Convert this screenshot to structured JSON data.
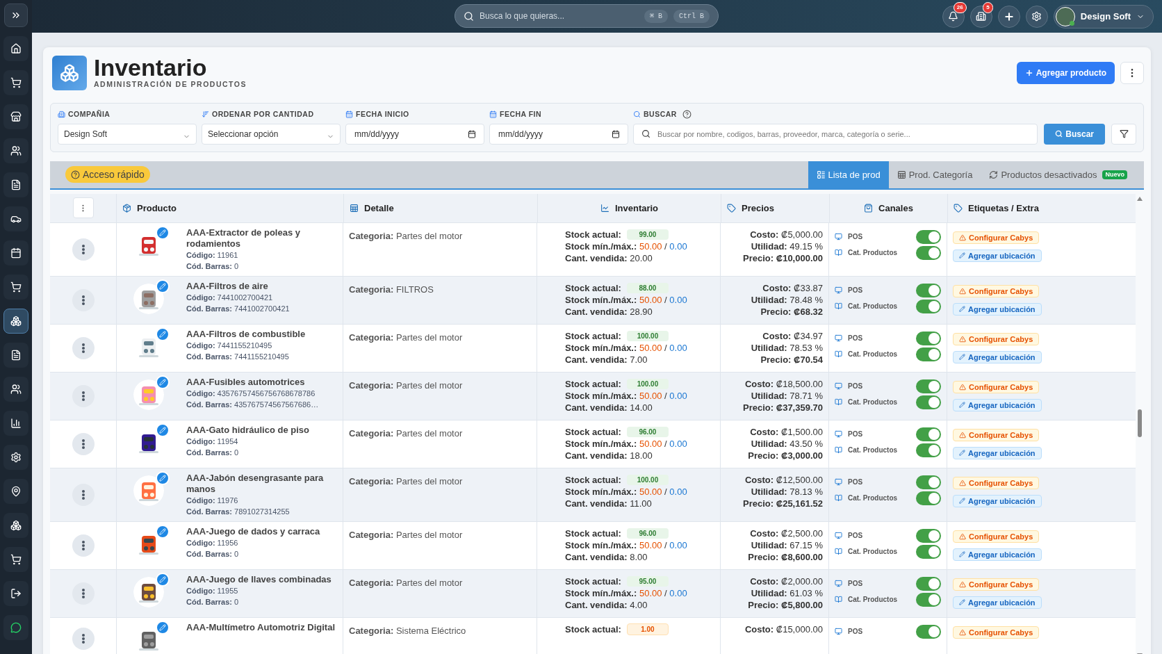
{
  "sidebar": {
    "items": [
      {
        "selected": false
      },
      {
        "selected": false
      },
      {
        "selected": false
      },
      {
        "selected": false
      },
      {
        "selected": false
      },
      {
        "selected": false
      },
      {
        "selected": false
      },
      {
        "selected": false
      },
      {
        "selected": true
      },
      {
        "selected": false
      },
      {
        "selected": false
      },
      {
        "selected": false
      },
      {
        "selected": false
      },
      {
        "selected": false
      },
      {
        "selected": false
      },
      {
        "selected": false
      },
      {
        "selected": false
      }
    ]
  },
  "topbar": {
    "search": {
      "placeholder": "Busca lo que quieras...",
      "keys": [
        "⌘ B",
        "Ctrl B"
      ]
    },
    "notifications": "26",
    "alerts": "5",
    "user": "Design Soft"
  },
  "header": {
    "title": "Inventario",
    "subtitle": "ADMINISTRACIÓN DE PRODUCTOS",
    "add_button": "Agregar producto"
  },
  "filters": {
    "company": {
      "label": "COMPAÑIA",
      "value": "Design Soft"
    },
    "order": {
      "label": "ORDENAR POR CANTIDAD",
      "value": "Seleccionar opción"
    },
    "start": {
      "label": "FECHA INICIO",
      "placeholder": "mm/dd/yyyy"
    },
    "end": {
      "label": "FECHA FIN",
      "placeholder": "mm/dd/yyyy"
    },
    "search": {
      "label": "BUSCAR",
      "placeholder": "Buscar por nombre, codigos, barras, proveedor, marca, categoría o serie..."
    },
    "search_button": "Buscar"
  },
  "quick_access": "Acceso rápido",
  "tabs": [
    {
      "label": "Lista de prod",
      "selected": true
    },
    {
      "label": "Prod. Categoría",
      "selected": false
    },
    {
      "label": "Productos desactivados",
      "selected": false,
      "badge": "Nuevo"
    }
  ],
  "table": {
    "columns": [
      "Producto",
      "Detalle",
      "Inventario",
      "Precios",
      "Canales",
      "Etiquetas / Extra"
    ],
    "rows": [
      {
        "name": "AAA-Extractor de poleas y rodamientos",
        "codes": [
          {
            "label": "Código:",
            "value": "11961"
          },
          {
            "label": "Cód. Barras:",
            "value": "0"
          }
        ],
        "detail": {
          "label": "Categoria:",
          "value": "Partes del motor"
        },
        "stock": {
          "label": "Stock actual:",
          "value": "99.00",
          "low": false
        },
        "minmax": {
          "label": "Stock mín./máx.:",
          "min": "50.00",
          "sep": "/",
          "max": "0.00"
        },
        "sold": {
          "label": "Cant. vendida:",
          "value": "20.00"
        },
        "prices": [
          {
            "label": "Costo:",
            "value": "₡5,000.00",
            "bold": false
          },
          {
            "label": "Utilidad:",
            "value": "49.15 %",
            "bold": false
          },
          {
            "label": "Precio:",
            "value": "₡10,000.00",
            "bold": true
          }
        ],
        "channels": [
          {
            "label": "POS",
            "on": true
          },
          {
            "label": "Cat. Productos",
            "on": true
          }
        ],
        "tags": [
          {
            "kind": "warning",
            "label": "Configurar Cabys"
          },
          {
            "kind": "location",
            "label": "Agregar ubicación"
          }
        ]
      },
      {
        "name": "AAA-Filtros de aire",
        "codes": [
          {
            "label": "Código:",
            "value": "7441002700421"
          },
          {
            "label": "Cód. Barras:",
            "value": "7441002700421"
          }
        ],
        "detail": {
          "label": "Categoria:",
          "value": "FILTROS"
        },
        "stock": {
          "label": "Stock actual:",
          "value": "88.00",
          "low": false
        },
        "minmax": {
          "label": "Stock mín./máx.:",
          "min": "50.00",
          "sep": "/",
          "max": "0.00"
        },
        "sold": {
          "label": "Cant. vendida:",
          "value": "28.90"
        },
        "prices": [
          {
            "label": "Costo:",
            "value": "₡33.87",
            "bold": false
          },
          {
            "label": "Utilidad:",
            "value": "78.48 %",
            "bold": false
          },
          {
            "label": "Precio:",
            "value": "₡68.32",
            "bold": true
          }
        ],
        "channels": [
          {
            "label": "POS",
            "on": true
          },
          {
            "label": "Cat. Productos",
            "on": true
          }
        ],
        "tags": [
          {
            "kind": "warning",
            "label": "Configurar Cabys"
          },
          {
            "kind": "location",
            "label": "Agregar ubicación"
          }
        ]
      },
      {
        "name": "AAA-Filtros de combustible",
        "codes": [
          {
            "label": "Código:",
            "value": "7441155210495"
          },
          {
            "label": "Cód. Barras:",
            "value": "7441155210495"
          }
        ],
        "detail": {
          "label": "Categoria:",
          "value": "Partes del motor"
        },
        "stock": {
          "label": "Stock actual:",
          "value": "100.00",
          "low": false
        },
        "minmax": {
          "label": "Stock mín./máx.:",
          "min": "50.00",
          "sep": "/",
          "max": "0.00"
        },
        "sold": {
          "label": "Cant. vendida:",
          "value": "7.00"
        },
        "prices": [
          {
            "label": "Costo:",
            "value": "₡34.97",
            "bold": false
          },
          {
            "label": "Utilidad:",
            "value": "78.53 %",
            "bold": false
          },
          {
            "label": "Precio:",
            "value": "₡70.54",
            "bold": true
          }
        ],
        "channels": [
          {
            "label": "POS",
            "on": true
          },
          {
            "label": "Cat. Productos",
            "on": true
          }
        ],
        "tags": [
          {
            "kind": "warning",
            "label": "Configurar Cabys"
          },
          {
            "kind": "location",
            "label": "Agregar ubicación"
          }
        ]
      },
      {
        "name": "AAA-Fusibles automotrices",
        "codes": [
          {
            "label": "Código:",
            "value": "43576757456756768678786"
          },
          {
            "label": "Cód. Barras:",
            "value": "435767574567567686…"
          }
        ],
        "detail": {
          "label": "Categoria:",
          "value": "Partes del motor"
        },
        "stock": {
          "label": "Stock actual:",
          "value": "100.00",
          "low": false
        },
        "minmax": {
          "label": "Stock mín./máx.:",
          "min": "50.00",
          "sep": "/",
          "max": "0.00"
        },
        "sold": {
          "label": "Cant. vendida:",
          "value": "14.00"
        },
        "prices": [
          {
            "label": "Costo:",
            "value": "₡18,500.00",
            "bold": false
          },
          {
            "label": "Utilidad:",
            "value": "78.71 %",
            "bold": false
          },
          {
            "label": "Precio:",
            "value": "₡37,359.70",
            "bold": true
          }
        ],
        "channels": [
          {
            "label": "POS",
            "on": true
          },
          {
            "label": "Cat. Productos",
            "on": true
          }
        ],
        "tags": [
          {
            "kind": "warning",
            "label": "Configurar Cabys"
          },
          {
            "kind": "location",
            "label": "Agregar ubicación"
          }
        ]
      },
      {
        "name": "AAA-Gato hidráulico de piso",
        "codes": [
          {
            "label": "Código:",
            "value": "11954"
          },
          {
            "label": "Cód. Barras:",
            "value": "0"
          }
        ],
        "detail": {
          "label": "Categoria:",
          "value": "Partes del motor"
        },
        "stock": {
          "label": "Stock actual:",
          "value": "96.00",
          "low": false
        },
        "minmax": {
          "label": "Stock mín./máx.:",
          "min": "50.00",
          "sep": "/",
          "max": "0.00"
        },
        "sold": {
          "label": "Cant. vendida:",
          "value": "18.00"
        },
        "prices": [
          {
            "label": "Costo:",
            "value": "₡1,500.00",
            "bold": false
          },
          {
            "label": "Utilidad:",
            "value": "43.50 %",
            "bold": false
          },
          {
            "label": "Precio:",
            "value": "₡3,000.00",
            "bold": true
          }
        ],
        "channels": [
          {
            "label": "POS",
            "on": true
          },
          {
            "label": "Cat. Productos",
            "on": true
          }
        ],
        "tags": [
          {
            "kind": "warning",
            "label": "Configurar Cabys"
          },
          {
            "kind": "location",
            "label": "Agregar ubicación"
          }
        ]
      },
      {
        "name": "AAA-Jabón desengrasante para manos",
        "codes": [
          {
            "label": "Código:",
            "value": "11976"
          },
          {
            "label": "Cód. Barras:",
            "value": "7891027314255"
          }
        ],
        "detail": {
          "label": "Categoria:",
          "value": "Partes del motor"
        },
        "stock": {
          "label": "Stock actual:",
          "value": "100.00",
          "low": false
        },
        "minmax": {
          "label": "Stock mín./máx.:",
          "min": "50.00",
          "sep": "/",
          "max": "0.00"
        },
        "sold": {
          "label": "Cant. vendida:",
          "value": "11.00"
        },
        "prices": [
          {
            "label": "Costo:",
            "value": "₡12,500.00",
            "bold": false
          },
          {
            "label": "Utilidad:",
            "value": "78.13 %",
            "bold": false
          },
          {
            "label": "Precio:",
            "value": "₡25,161.52",
            "bold": true
          }
        ],
        "channels": [
          {
            "label": "POS",
            "on": true
          },
          {
            "label": "Cat. Productos",
            "on": true
          }
        ],
        "tags": [
          {
            "kind": "warning",
            "label": "Configurar Cabys"
          },
          {
            "kind": "location",
            "label": "Agregar ubicación"
          }
        ]
      },
      {
        "name": "AAA-Juego de dados y carraca",
        "codes": [
          {
            "label": "Código:",
            "value": "11956"
          },
          {
            "label": "Cód. Barras:",
            "value": "0"
          }
        ],
        "detail": {
          "label": "Categoria:",
          "value": "Partes del motor"
        },
        "stock": {
          "label": "Stock actual:",
          "value": "96.00",
          "low": false
        },
        "minmax": {
          "label": "Stock mín./máx.:",
          "min": "50.00",
          "sep": "/",
          "max": "0.00"
        },
        "sold": {
          "label": "Cant. vendida:",
          "value": "8.00"
        },
        "prices": [
          {
            "label": "Costo:",
            "value": "₡2,500.00",
            "bold": false
          },
          {
            "label": "Utilidad:",
            "value": "67.15 %",
            "bold": false
          },
          {
            "label": "Precio:",
            "value": "₡8,600.00",
            "bold": true
          }
        ],
        "channels": [
          {
            "label": "POS",
            "on": true
          },
          {
            "label": "Cat. Productos",
            "on": true
          }
        ],
        "tags": [
          {
            "kind": "warning",
            "label": "Configurar Cabys"
          },
          {
            "kind": "location",
            "label": "Agregar ubicación"
          }
        ]
      },
      {
        "name": "AAA-Juego de llaves combinadas",
        "codes": [
          {
            "label": "Código:",
            "value": "11955"
          },
          {
            "label": "Cód. Barras:",
            "value": "0"
          }
        ],
        "detail": {
          "label": "Categoria:",
          "value": "Partes del motor"
        },
        "stock": {
          "label": "Stock actual:",
          "value": "95.00",
          "low": false
        },
        "minmax": {
          "label": "Stock mín./máx.:",
          "min": "50.00",
          "sep": "/",
          "max": "0.00"
        },
        "sold": {
          "label": "Cant. vendida:",
          "value": "4.00"
        },
        "prices": [
          {
            "label": "Costo:",
            "value": "₡2,000.00",
            "bold": false
          },
          {
            "label": "Utilidad:",
            "value": "61.03 %",
            "bold": false
          },
          {
            "label": "Precio:",
            "value": "₡5,800.00",
            "bold": true
          }
        ],
        "channels": [
          {
            "label": "POS",
            "on": true
          },
          {
            "label": "Cat. Productos",
            "on": true
          }
        ],
        "tags": [
          {
            "kind": "warning",
            "label": "Configurar Cabys"
          },
          {
            "kind": "location",
            "label": "Agregar ubicación"
          }
        ]
      },
      {
        "name": "AAA-Multímetro Automotriz Digital",
        "detail": {
          "label": "Categoria:",
          "value": "Sistema Eléctrico"
        },
        "stock": {
          "label": "Stock actual:",
          "value": "1.00",
          "low": true
        },
        "prices": [
          {
            "label": "Costo:",
            "value": "₡15,000.00",
            "bold": false
          }
        ],
        "channels": [
          {
            "label": "POS",
            "on": true
          }
        ],
        "tags": [
          {
            "kind": "warning",
            "label": "Configurar Cabys"
          }
        ]
      }
    ]
  }
}
